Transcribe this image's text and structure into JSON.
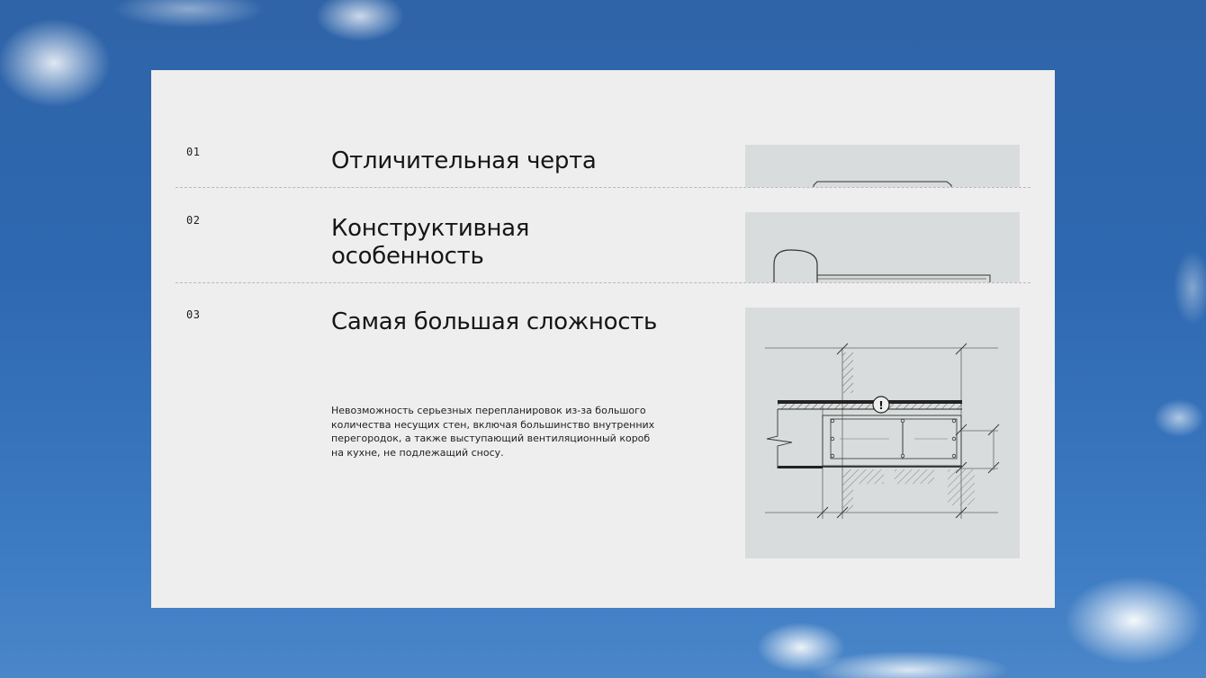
{
  "sections": [
    {
      "number": "01",
      "title": "Отличительная черта"
    },
    {
      "number": "02",
      "title": "Конструктивная особенность"
    },
    {
      "number": "03",
      "title": "Самая большая сложность",
      "description": "Невозможность серьезных перепланировок из-за большого количества несущих стен, включая большинство внутренних перегородок, а также выступающий вентиляционный короб на кухне, не подлежащий сносу."
    }
  ],
  "drawing": {
    "warning_mark": "!"
  },
  "colors": {
    "card_background": "#eeeeee",
    "thumbnail_background": "#d9dcdc",
    "sky": "#2f64a8"
  }
}
